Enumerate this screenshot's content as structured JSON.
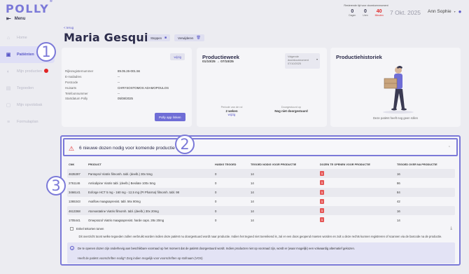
{
  "app": {
    "logo": "POLLY",
    "logo_mark": "®",
    "menu_label": "Menu"
  },
  "sidebar": {
    "items": [
      {
        "label": "Home",
        "icon": "home-icon"
      },
      {
        "label": "Patiënten",
        "icon": "users-icon",
        "active": true
      },
      {
        "label": "Mijn producten",
        "icon": "pill-icon",
        "badge": true
      },
      {
        "label": "Tegoeden",
        "icon": "wallet-icon"
      },
      {
        "label": "Mijn opvolsbak",
        "icon": "inbox-icon"
      },
      {
        "label": "Formulaplan",
        "icon": "list-icon"
      }
    ]
  },
  "top": {
    "stats_caption": "Resterende tijd voor doorsturenmoment",
    "stats": [
      {
        "num": "0",
        "label": "Dagen"
      },
      {
        "num": "0",
        "label": "Uren"
      },
      {
        "num": "40",
        "label": "Minuten",
        "red": true
      }
    ],
    "date": "7 Okt. 2025",
    "user": "Ann Sophie"
  },
  "header": {
    "back": "< terug",
    "patient_name": "Maria Gesquiere",
    "stop_button": "Stoppen",
    "delete_button": "Verwijderen"
  },
  "info_card": {
    "edit": "wijzig",
    "rows": [
      {
        "k": "Rijksregisternummer",
        "v": "89.05.26-001.56"
      },
      {
        "k": "E-mailadres",
        "v": "--"
      },
      {
        "k": "Postcode",
        "v": "--"
      },
      {
        "k": "Huisarts",
        "v": "CHRYSOSTOMOS ADAMOPOULOS"
      },
      {
        "k": "Telefoonnummer",
        "v": "--"
      },
      {
        "k": "Startdatum Polly",
        "v": "05/08/2025"
      }
    ],
    "app_button": "Polly app linken"
  },
  "week_card": {
    "title": "Productieweek",
    "range": "01/10/25 → 07/10/25",
    "next_label": "Volgende doorstuurmoment",
    "next_date": "07/10/2025",
    "period_label": "Periode van de rol",
    "period_value": "2 weken",
    "period_link": "wijzig",
    "sent_label": "Doorgestuurd op",
    "sent_value": "Nog niet doorgestuurd"
  },
  "history_card": {
    "title": "Productiehistoriek",
    "empty": "Deze patiënt heeft nog geen rollen"
  },
  "alert": {
    "title": "6 nieuwe dozen nodig voor komende productie",
    "columns": [
      "CNK",
      "PRODUCT",
      "HUIDIG TEGOED",
      "TEGOED NODIG VOOR PRODUCTIE",
      "DOZEN TE OPENEN VOOR PRODUCTIE",
      "TEGOED OVER NA PRODUCTIE"
    ],
    "rows": [
      [
        "4635397",
        "Pantoprol Viatris filmomh. tabl. (deelb.) 30x 5mg",
        "0",
        "14",
        "1",
        "16"
      ],
      [
        "2761146",
        "Amlodipine Viatris tabl. (deelb.) Besilate 100x 5mg",
        "0",
        "14",
        "1",
        "86"
      ],
      [
        "3466141",
        "Exforge HCT 5 mg - 160 mg - 12,5 mg (PI Pharma) filmomh. tabl. 98",
        "0",
        "14",
        "1",
        "84"
      ],
      [
        "1365343",
        "Asaflow maagsapresist. tabl. 56x 80mg",
        "0",
        "14",
        "1",
        "42"
      ],
      [
        "4613368",
        "Atorvastatine Viatris filmomh. tabl. (deelb.) 30x 20mg",
        "0",
        "14",
        "1",
        "16"
      ],
      [
        "1705441",
        "Omeprazol Viatris maagsapresist. harde caps. 28x 20mg",
        "0",
        "14",
        "1",
        "14"
      ]
    ],
    "print_label": "Enkel tekorten tonen",
    "explain": "Dit overzicht toont welke tegoeden zullen verbruikt worden indien deze patiënt nu doorgestuurd wordt naar productie. Indien het tegoed niet toereikend is, zal er een doos geopend moeten worden en zult u deze rechts kunnen registreren of scannen via de barcode na de productie.",
    "notice_1": "De te openen dozen zijn onderhevig aan beschikbare voorraad op het moment dat de patiënt doorgestuurd wordt. Indien producten niet op voorraad zijn, wordt er (waar mogelijk) een volwaardig alternatief gekozen.",
    "notice_2": "Heeft de patiënt voorschriften nodig? Zorg indien mogelijk voor voorschriften op stofnaam (VOS)"
  },
  "annotations": [
    "1",
    "2",
    "3"
  ],
  "colors": {
    "accent": "#7b79d8",
    "primary": "#6f6dd6",
    "danger": "#e02424"
  }
}
